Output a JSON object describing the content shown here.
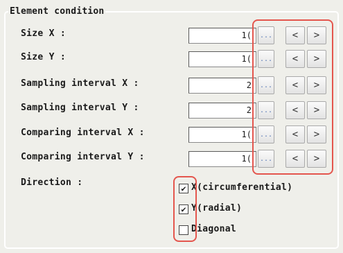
{
  "group": {
    "title": "Element condition"
  },
  "rows": [
    {
      "label": "Size X :",
      "value": "1("
    },
    {
      "label": "Size Y :",
      "value": "1("
    },
    {
      "label": "Sampling interval X :",
      "value": "2"
    },
    {
      "label": "Sampling interval Y :",
      "value": "2"
    },
    {
      "label": "Comparing interval X :",
      "value": "1("
    },
    {
      "label": "Comparing interval Y :",
      "value": "1("
    }
  ],
  "buttons": {
    "more": "...",
    "prev": "<",
    "next": ">"
  },
  "direction": {
    "label": "Direction :",
    "options": [
      {
        "label": "X(circumferential)",
        "checked": true
      },
      {
        "label": "Y(radial)",
        "checked": true
      },
      {
        "label": "Diagonal",
        "checked": false
      }
    ]
  },
  "colors": {
    "highlight": "#e4564e",
    "panel": "#efefea"
  }
}
